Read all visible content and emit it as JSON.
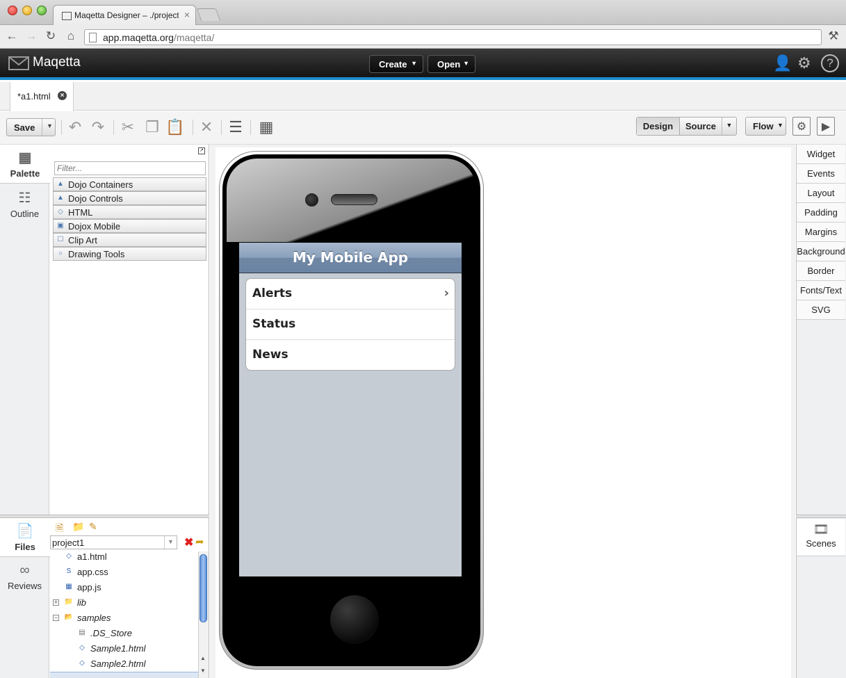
{
  "browser": {
    "tab_title": "Maqetta Designer – ./project1",
    "url_host": "app.maqetta.org",
    "url_path": "/maqetta/"
  },
  "app": {
    "name": "Maqetta",
    "create_label": "Create",
    "open_label": "Open"
  },
  "editor_tab": {
    "label": "*a1.html"
  },
  "toolbar": {
    "save_label": "Save",
    "design_label": "Design",
    "source_label": "Source",
    "flow_label": "Flow"
  },
  "left_panel": {
    "tabs": [
      {
        "label": "Palette"
      },
      {
        "label": "Outline"
      }
    ],
    "filter_placeholder": "Filter...",
    "palette_sections": [
      {
        "label": "Dojo Containers"
      },
      {
        "label": "Dojo Controls"
      },
      {
        "label": "HTML"
      },
      {
        "label": "Dojox Mobile"
      },
      {
        "label": "Clip Art"
      },
      {
        "label": "Drawing Tools"
      }
    ]
  },
  "files_panel": {
    "tabs": [
      {
        "label": "Files"
      },
      {
        "label": "Reviews"
      }
    ],
    "project": "project1",
    "items": [
      {
        "label": "a1.html"
      },
      {
        "label": "app.css"
      },
      {
        "label": "app.js"
      },
      {
        "label": "lib"
      },
      {
        "label": "samples"
      },
      {
        "label": ".DS_Store"
      },
      {
        "label": "Sample1.html"
      },
      {
        "label": "Sample2.html"
      }
    ]
  },
  "mobile_app": {
    "title": "My Mobile App",
    "list": [
      {
        "label": "Alerts"
      },
      {
        "label": "Status"
      },
      {
        "label": "News"
      }
    ]
  },
  "right_panel": {
    "tabs": [
      {
        "label": "Widget"
      },
      {
        "label": "Events"
      },
      {
        "label": "Layout"
      },
      {
        "label": "Padding"
      },
      {
        "label": "Margins"
      },
      {
        "label": "Background"
      },
      {
        "label": "Border"
      },
      {
        "label": "Fonts/Text"
      },
      {
        "label": "SVG"
      }
    ],
    "scenes_label": "Scenes"
  },
  "colors": {
    "accent": "#1b8ccd",
    "header": "#1a1a1a",
    "mobile_screen": "#c5ccd4"
  }
}
